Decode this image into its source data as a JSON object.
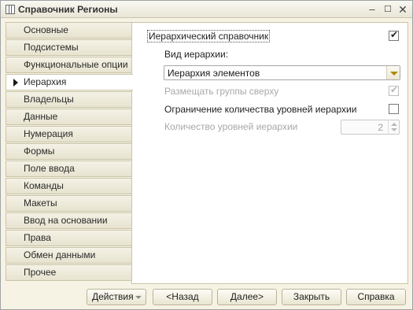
{
  "window": {
    "title": "Справочник Регионы"
  },
  "tabs": [
    {
      "label": "Основные"
    },
    {
      "label": "Подсистемы"
    },
    {
      "label": "Функциональные опции"
    },
    {
      "label": "Иерархия"
    },
    {
      "label": "Владельцы"
    },
    {
      "label": "Данные"
    },
    {
      "label": "Нумерация"
    },
    {
      "label": "Формы"
    },
    {
      "label": "Поле ввода"
    },
    {
      "label": "Команды"
    },
    {
      "label": "Макеты"
    },
    {
      "label": "Ввод на основании"
    },
    {
      "label": "Права"
    },
    {
      "label": "Обмен данными"
    },
    {
      "label": "Прочее"
    }
  ],
  "active_tab": "Иерархия",
  "hierarchy": {
    "hierarchical_label": "Иерархический справочник",
    "hierarchical_checked": true,
    "hierarchy_type_label": "Вид иерархии:",
    "hierarchy_type_value": "Иерархия элементов",
    "place_groups_label": "Размещать группы сверху",
    "place_groups_checked": true,
    "limit_levels_label": "Ограничение количества уровней иерархии",
    "limit_levels_checked": false,
    "levels_count_label": "Количество уровней иерархии",
    "levels_count_value": "2"
  },
  "buttons": {
    "actions": "Действия",
    "back": "<Назад",
    "next": "Далее>",
    "close": "Закрыть",
    "help": "Справка"
  },
  "icons": {
    "window": "list-icon",
    "minimize": "minimize-icon",
    "maximize": "maximize-icon",
    "close": "close-icon",
    "active_tab": "triangle-right-icon",
    "check": "check-icon",
    "dropdown": "chevron-down-icon"
  }
}
